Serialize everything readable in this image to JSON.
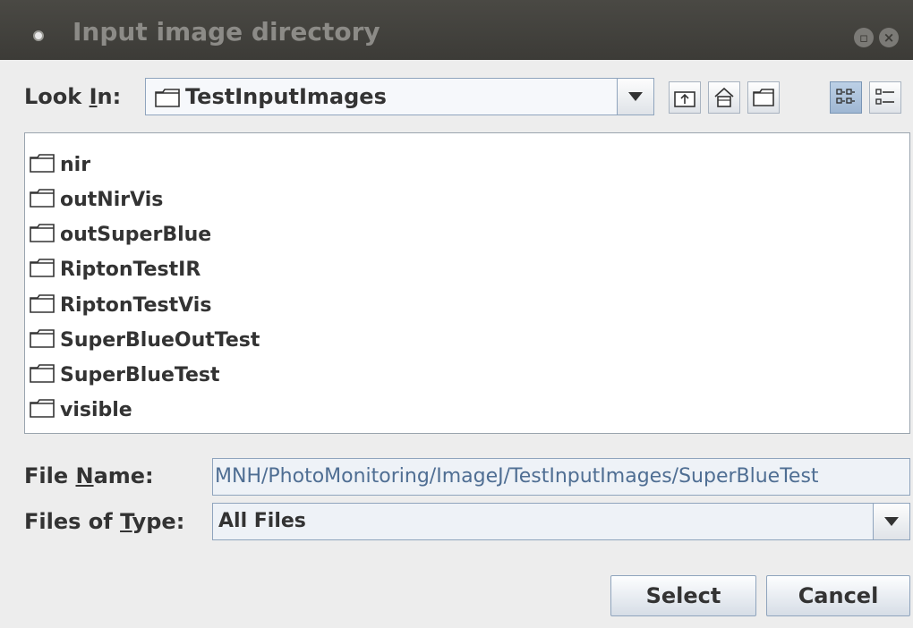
{
  "window": {
    "title": "Input image directory"
  },
  "look_in": {
    "label_pre": "Look ",
    "label_key": "I",
    "label_post": "n:",
    "value": "TestInputImages"
  },
  "toolbar": {
    "icons": [
      "up-one-level-icon",
      "home-icon",
      "new-folder-icon",
      "list-view-icon",
      "details-view-icon"
    ]
  },
  "files": [
    {
      "name": "nir"
    },
    {
      "name": "outNirVis"
    },
    {
      "name": "outSuperBlue"
    },
    {
      "name": "RiptonTestIR"
    },
    {
      "name": "RiptonTestVis"
    },
    {
      "name": "SuperBlueOutTest"
    },
    {
      "name": "SuperBlueTest"
    },
    {
      "name": "visible"
    }
  ],
  "file_name": {
    "label_pre": "File ",
    "label_key": "N",
    "label_post": "ame:",
    "value": "MNH/PhotoMonitoring/ImageJ/TestInputImages/SuperBlueTest"
  },
  "file_type": {
    "label_pre": "Files of ",
    "label_key": "T",
    "label_post": "ype:",
    "value": "All Files"
  },
  "buttons": {
    "select": "Select",
    "cancel": "Cancel"
  },
  "colors": {
    "titlebar": "#3c3b37",
    "accent": "#8fa4bd",
    "selected_toggle": "#9fb7d3"
  }
}
